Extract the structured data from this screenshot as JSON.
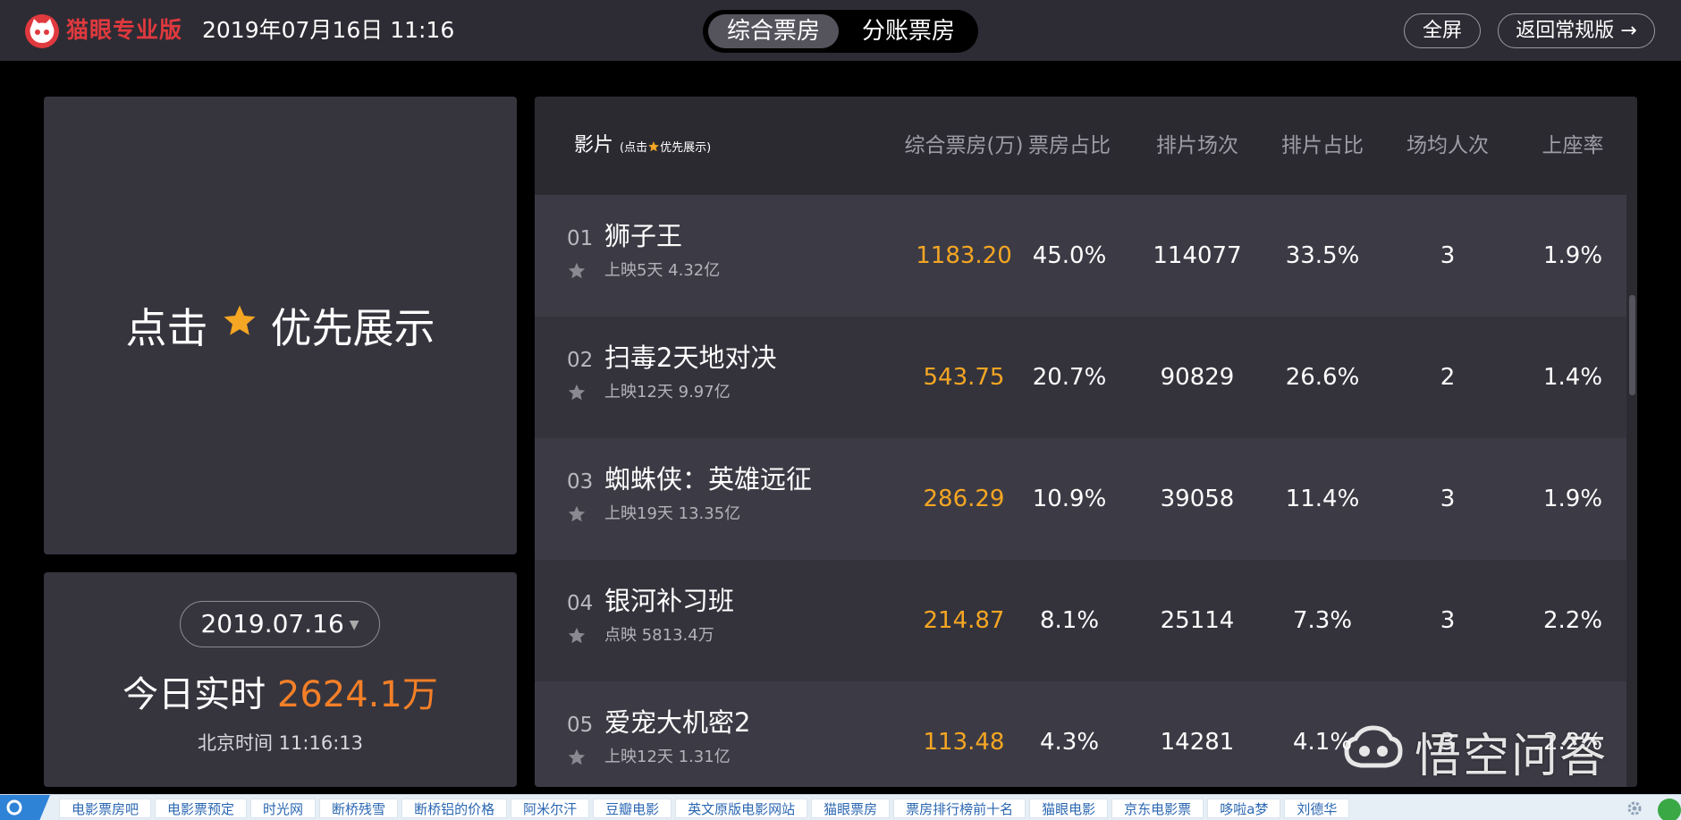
{
  "header": {
    "logo_text": "猫眼专业版",
    "datetime": "2019年07月16日 11:16",
    "tabs": [
      {
        "label": "综合票房",
        "active": true
      },
      {
        "label": "分账票房",
        "active": false
      }
    ],
    "fullscreen_label": "全屏",
    "back_label": "返回常规版 →"
  },
  "promo": {
    "left_text": "点击",
    "right_text": "优先展示",
    "star_icon": "star-icon"
  },
  "daily": {
    "date": "2019.07.16",
    "realtime_label": "今日实时",
    "realtime_value": "2624.1万",
    "beijing_time": "北京时间 11:16:13"
  },
  "table": {
    "columns": {
      "film": "影片",
      "film_note_prefix": "(点击",
      "film_note_suffix": "优先展示)",
      "box_office": "综合票房(万)",
      "box_share": "票房占比",
      "screenings": "排片场次",
      "screen_share": "排片占比",
      "avg_attendance": "场均人次",
      "occupancy": "上座率"
    },
    "rows": [
      {
        "rank": "01",
        "name": "狮子王",
        "sub": "上映5天  4.32亿",
        "box_office": "1183.20",
        "box_share": "45.0%",
        "screenings": "114077",
        "screen_share": "33.5%",
        "avg_attendance": "3",
        "occupancy": "1.9%"
      },
      {
        "rank": "02",
        "name": "扫毒2天地对决",
        "sub": "上映12天  9.97亿",
        "box_office": "543.75",
        "box_share": "20.7%",
        "screenings": "90829",
        "screen_share": "26.6%",
        "avg_attendance": "2",
        "occupancy": "1.4%"
      },
      {
        "rank": "03",
        "name": "蜘蛛侠：英雄远征",
        "sub": "上映19天  13.35亿",
        "box_office": "286.29",
        "box_share": "10.9%",
        "screenings": "39058",
        "screen_share": "11.4%",
        "avg_attendance": "3",
        "occupancy": "1.9%"
      },
      {
        "rank": "04",
        "name": "银河补习班",
        "sub": "点映  5813.4万",
        "box_office": "214.87",
        "box_share": "8.1%",
        "screenings": "25114",
        "screen_share": "7.3%",
        "avg_attendance": "3",
        "occupancy": "2.2%"
      },
      {
        "rank": "05",
        "name": "爱宠大机密2",
        "sub": "上映12天  1.31亿",
        "box_office": "113.48",
        "box_share": "4.3%",
        "screenings": "14281",
        "screen_share": "4.1%",
        "avg_attendance": "3",
        "occupancy": "2.2%"
      }
    ]
  },
  "watermark": {
    "text": "悟空问答"
  },
  "bookmarks": [
    "电影票房吧",
    "电影票预定",
    "时光网",
    "断桥残雪",
    "断桥铝的价格",
    "阿米尔汗",
    "豆瓣电影",
    "英文原版电影网站",
    "猫眼票房",
    "票房排行榜前十名",
    "猫眼电影",
    "京东电影票",
    "哆啦a梦",
    "刘德华"
  ],
  "colors": {
    "brand": "#e0393e",
    "box_office_value": "#f5a623",
    "realtime_value": "#f47f27",
    "star": "#f5a623"
  }
}
